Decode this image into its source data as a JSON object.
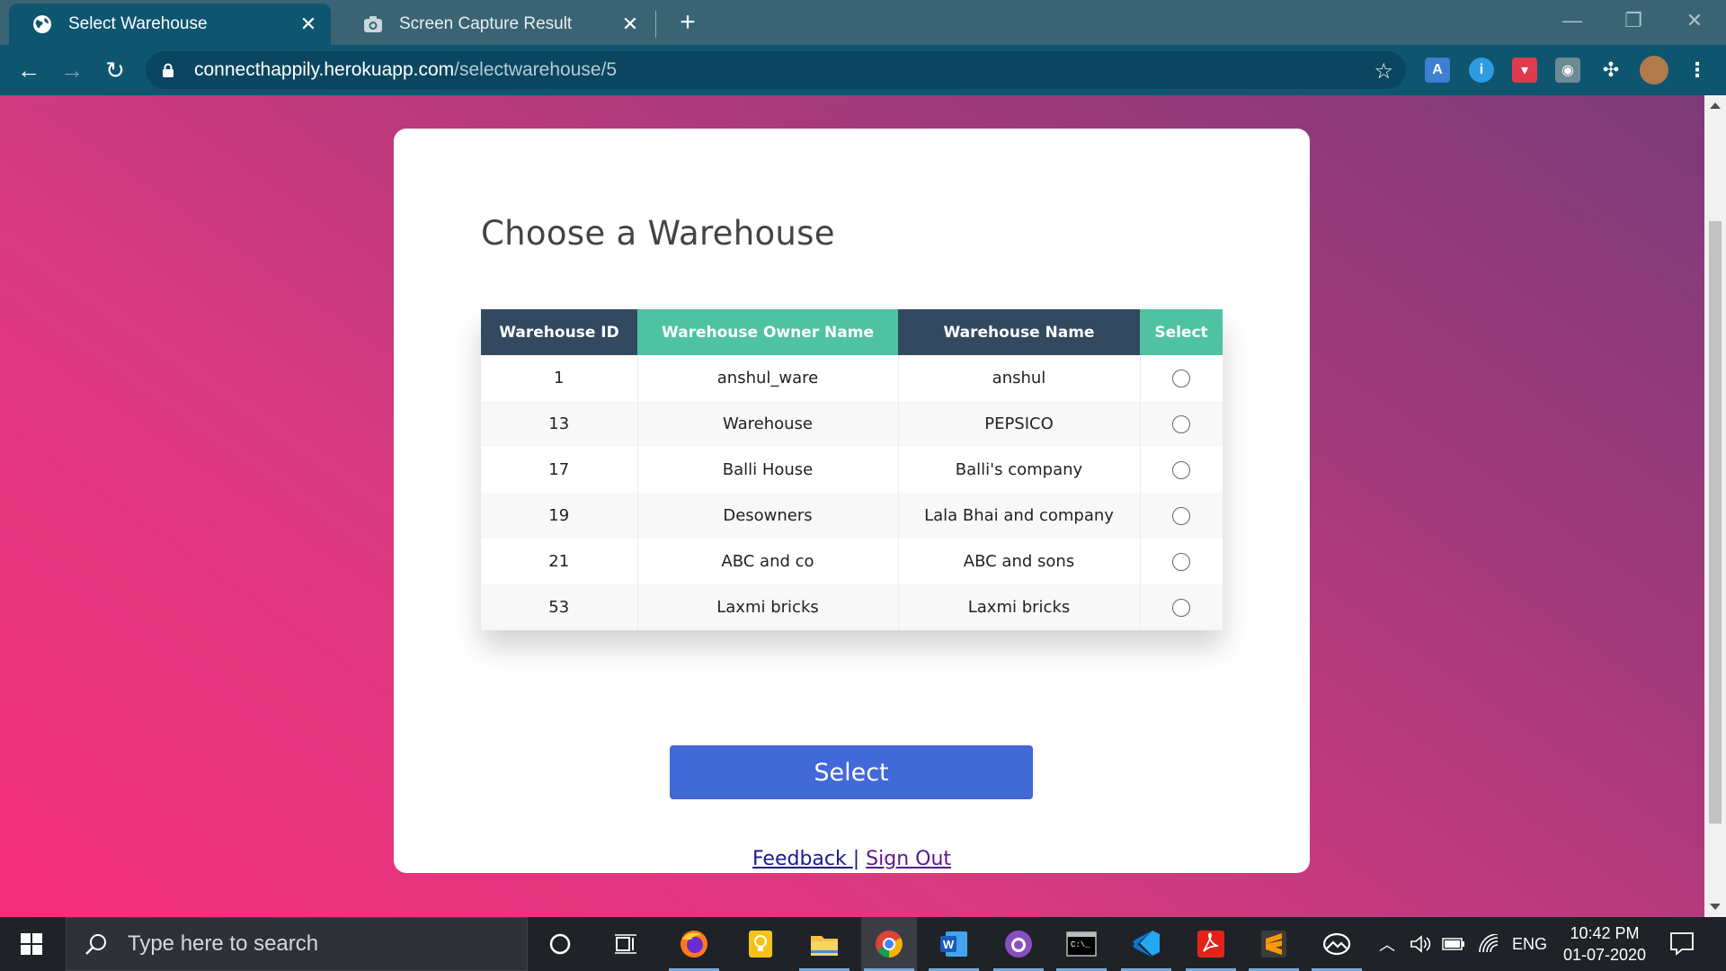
{
  "browser": {
    "tabs": [
      {
        "title": "Select Warehouse",
        "active": true
      },
      {
        "title": "Screen Capture Result",
        "active": false
      }
    ],
    "url_host": "connecthappily.herokuapp.com",
    "url_path": "/selectwarehouse/5"
  },
  "page": {
    "heading": "Choose a Warehouse",
    "table": {
      "headers": [
        "Warehouse ID",
        "Warehouse Owner Name",
        "Warehouse Name",
        "Select"
      ],
      "rows": [
        {
          "id": "1",
          "owner": "anshul_ware",
          "name": "anshul"
        },
        {
          "id": "13",
          "owner": "Warehouse",
          "name": "PEPSICO"
        },
        {
          "id": "17",
          "owner": "Balli House",
          "name": "Balli's company"
        },
        {
          "id": "19",
          "owner": "Desowners",
          "name": "Lala Bhai and company"
        },
        {
          "id": "21",
          "owner": "ABC and co",
          "name": "ABC and sons"
        },
        {
          "id": "53",
          "owner": "Laxmi bricks",
          "name": "Laxmi bricks"
        }
      ]
    },
    "select_button": "Select",
    "feedback_link": "Feedback ",
    "separator": "|",
    "signout_link": "Sign Out"
  },
  "taskbar": {
    "search_placeholder": "Type here to search",
    "language": "ENG",
    "time": "10:42 PM",
    "date": "01-07-2020"
  },
  "colors": {
    "header_dark": "#324960",
    "header_teal": "#4fc3a1",
    "button_blue": "#4169d8",
    "browser_chrome": "#0e5570"
  }
}
